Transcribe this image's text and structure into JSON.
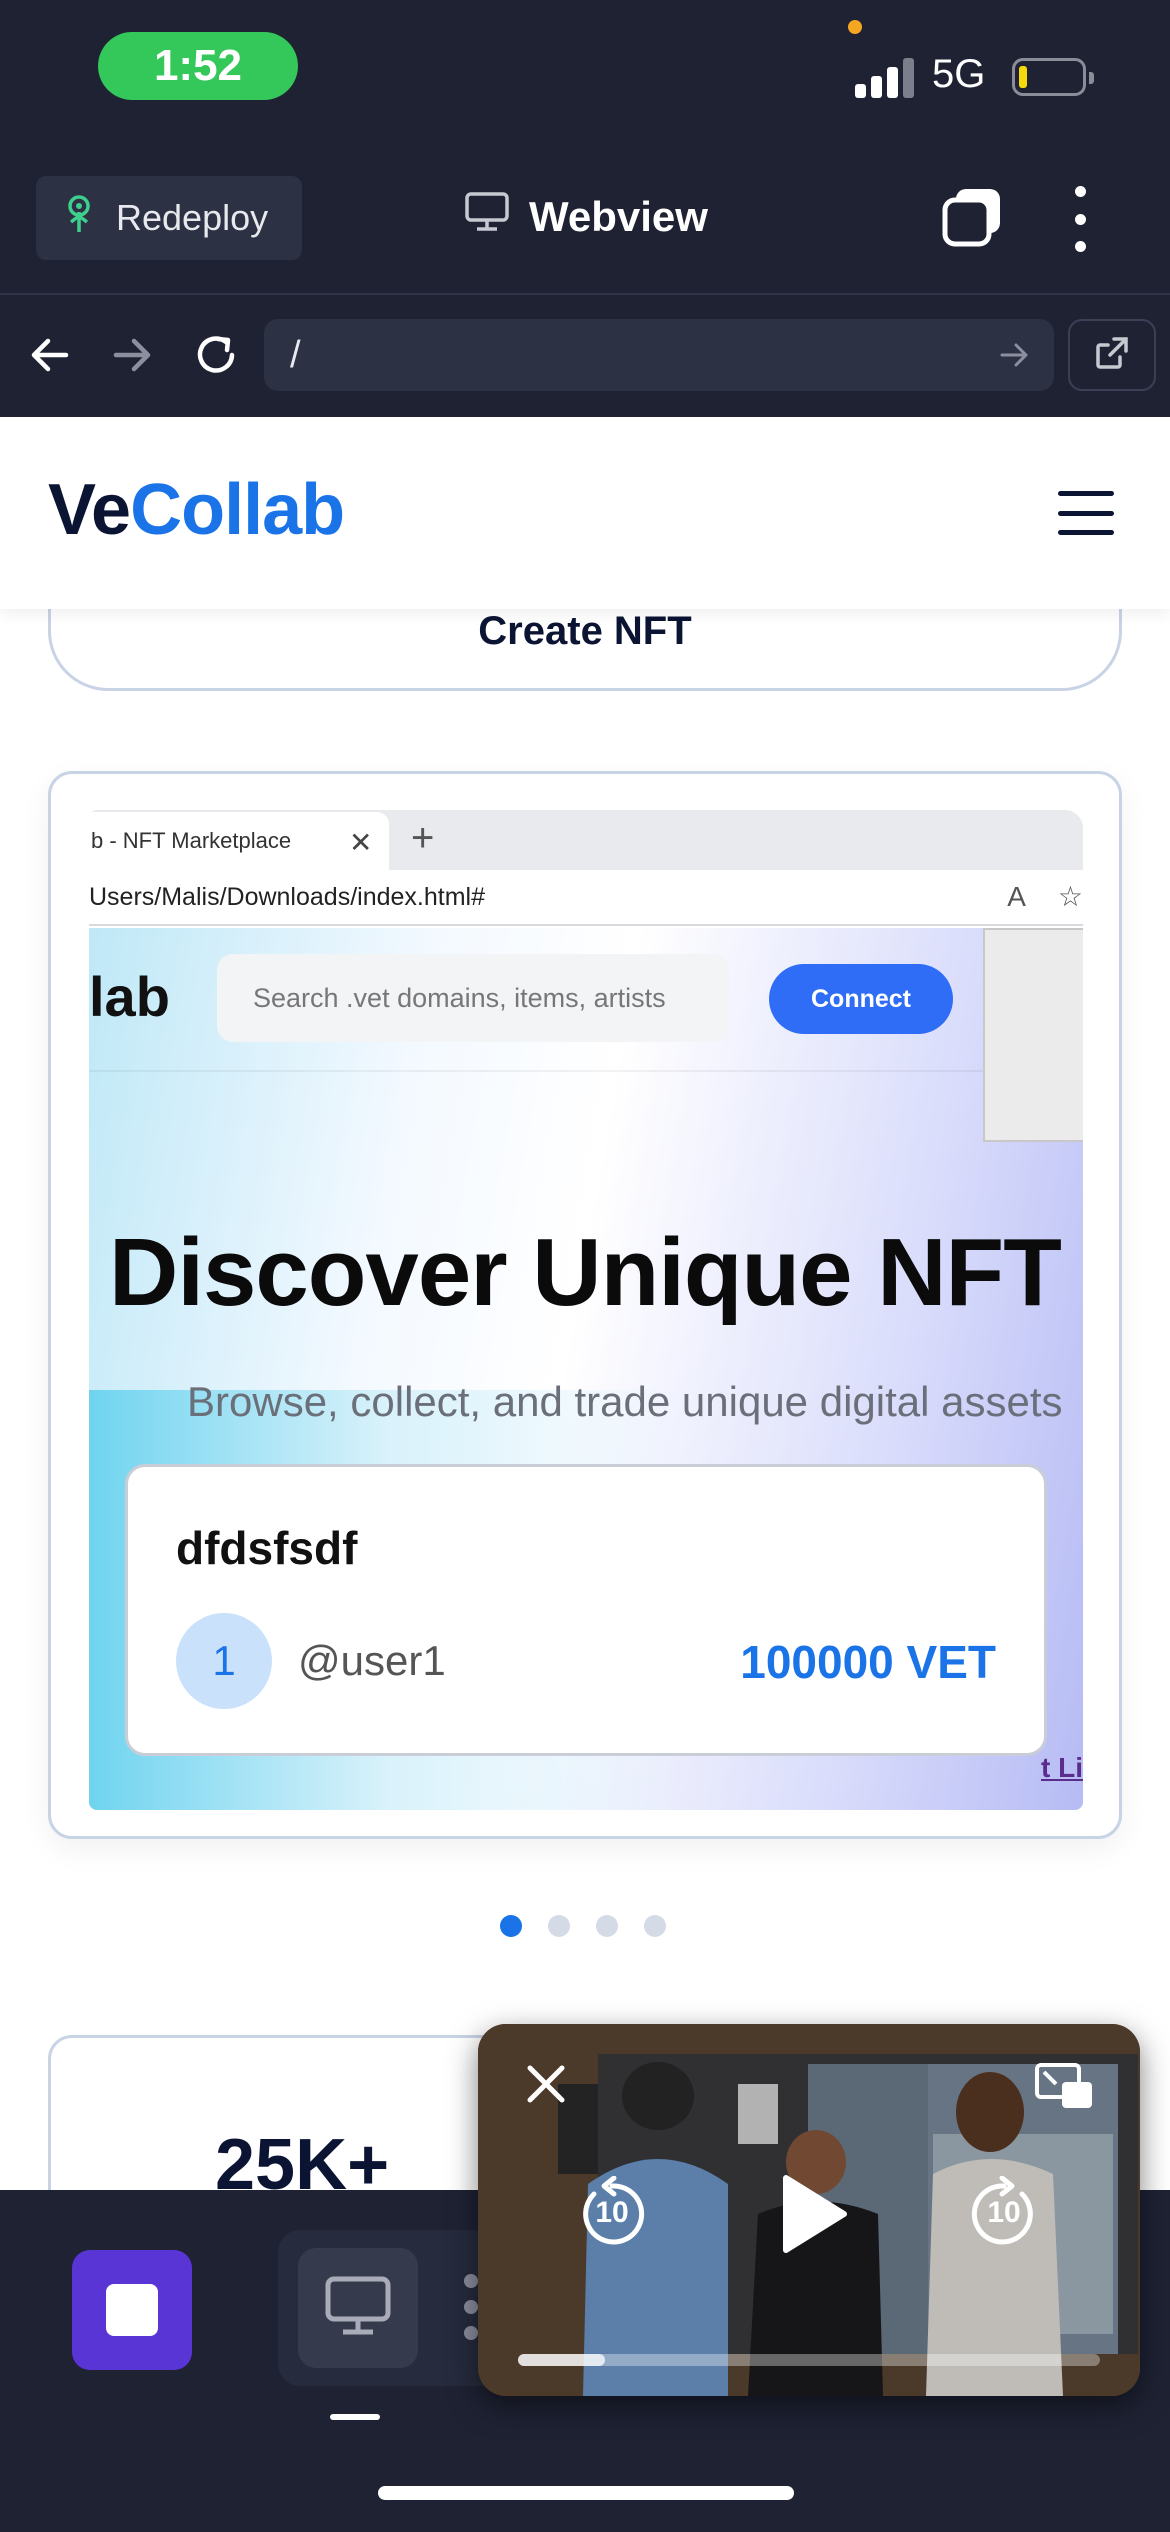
{
  "status_bar": {
    "time": "1:52",
    "network": "5G",
    "battery_level": 0.1
  },
  "toolbar": {
    "redeploy_label": "Redeploy",
    "title": "Webview"
  },
  "url_bar": {
    "url": "/"
  },
  "site": {
    "logo_ve": "Ve",
    "logo_collab": "Collab",
    "create_button": "Create NFT",
    "carousel": {
      "tab_title": "b - NFT Marketplace",
      "address": "Users/Malis/Downloads/index.html#",
      "mini_logo": "lab",
      "search_placeholder": "Search .vet domains, items, artists",
      "connect_label": "Connect",
      "hero_title": "Discover Unique NFT",
      "hero_subtitle": "Browse, collect, and trade unique digital assets",
      "item_name": "dfdsfsdf",
      "item_avatar": "1",
      "item_user": "@user1",
      "item_price": "100000 VET",
      "cut_link": "t Li",
      "active_slide": 1,
      "slide_count": 4
    },
    "stat_value": "25K+"
  },
  "video": {
    "rewind_seconds": "10",
    "forward_seconds": "10",
    "progress": 0.15
  },
  "colors": {
    "brand_blue": "#1b73e8",
    "dark": "#1e2233",
    "stop_purple": "#5a35d6",
    "time_green": "#34c759"
  }
}
